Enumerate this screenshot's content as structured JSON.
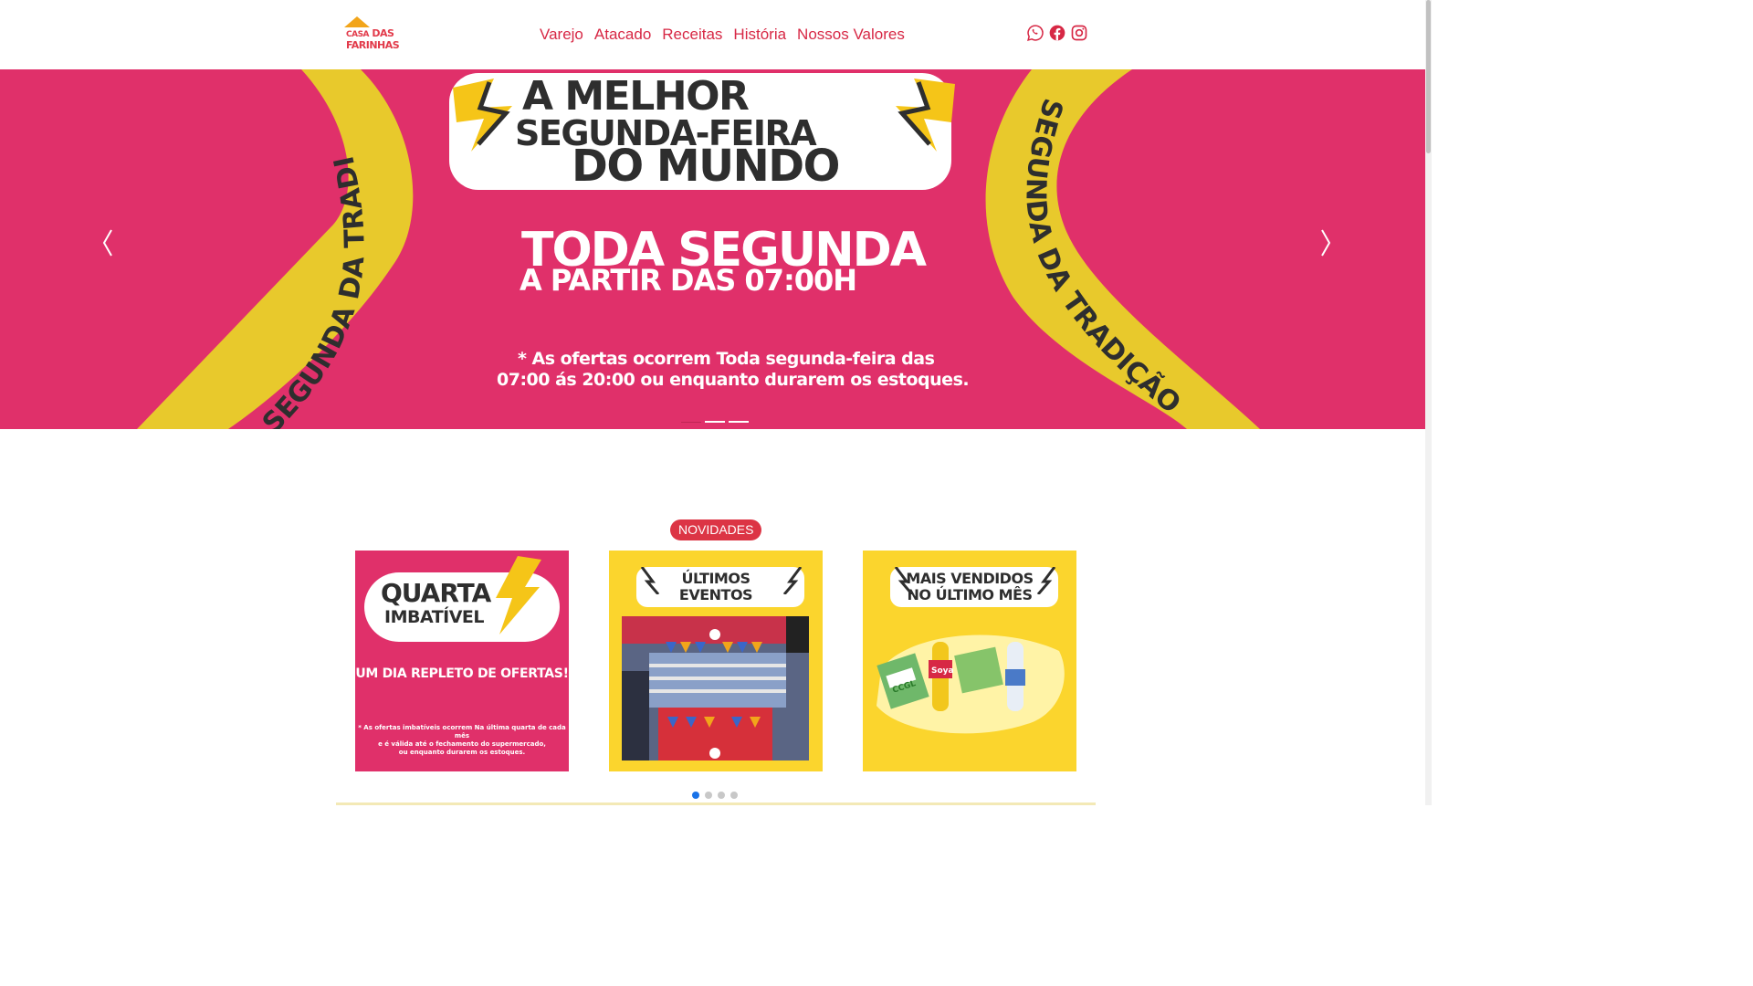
{
  "header": {
    "logo": {
      "line1a": "CASA",
      "line1b": "DAS",
      "line2": "FARINHAS"
    },
    "nav": [
      "Varejo",
      "Atacado",
      "Receitas",
      "História",
      "Nossos Valores"
    ],
    "social": [
      "whatsapp-icon",
      "facebook-icon",
      "instagram-icon"
    ]
  },
  "hero": {
    "card_line1": "A MELHOR",
    "card_line2": "SEGUNDA-FEIRA",
    "card_line3": "DO MUNDO",
    "band_text": "SEGUNDA DA TRADIÇÃO",
    "headline": "TODA SEGUNDA",
    "subheadline": "A PARTIR DAS 07:00H",
    "note_line1": "* As ofertas ocorrem Toda segunda-feira das",
    "note_line2": "07:00 ás 20:00  ou enquanto durarem os estoques.",
    "slides": 3,
    "active_slide": 1,
    "colors": {
      "background": "#e0306a",
      "band": "#e8c92c",
      "text_dark": "#2e2e2e"
    }
  },
  "novidades": {
    "badge": "NOVIDADES",
    "cards": [
      {
        "title1": "QUARTA",
        "title2": "IMBATÍVEL",
        "subtitle": "UM DIA REPLETO DE OFERTAS!",
        "fine1": "* As ofertas imbatíveis ocorrem Na última quarta de cada mês",
        "fine2": "e é válida até o fechamento do supermercado,",
        "fine3": "ou enquanto durarem os estoques."
      },
      {
        "title1": "ÚLTIMOS",
        "title2": "EVENTOS"
      },
      {
        "title1": "MAIS VENDIDOS",
        "title2": "NO ÚLTIMO MÊS",
        "products": [
          "CCGL",
          "Soya"
        ]
      }
    ],
    "pages": 4,
    "active_page": 1
  }
}
